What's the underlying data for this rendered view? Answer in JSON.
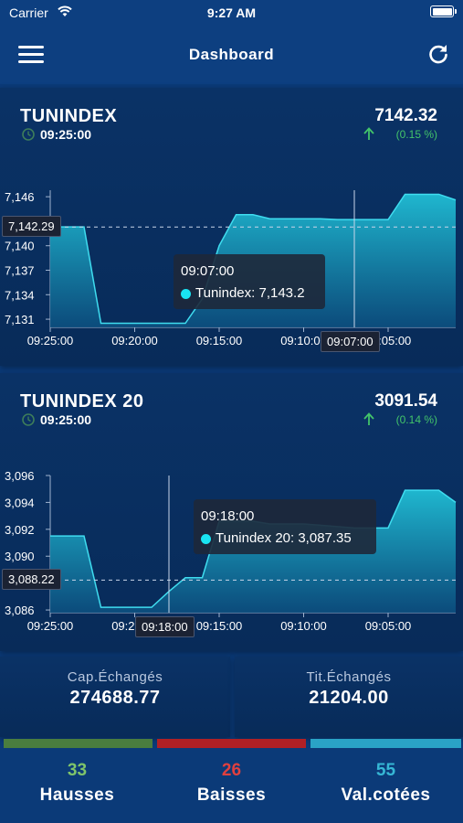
{
  "status_bar": {
    "carrier": "Carrier",
    "time": "9:27 AM"
  },
  "navbar": {
    "title": "Dashboard",
    "menu_icon": "hamburger-menu-icon",
    "refresh_icon": "refresh-icon"
  },
  "cards": [
    {
      "name": "TUNINDEX",
      "time": "09:25:00",
      "value": "7142.32",
      "change": "(0.15 %)",
      "crosshair_value": "7,142.29",
      "tooltip_time": "09:07:00",
      "tooltip_value": "Tunindex: 7,143.2",
      "cursor_badge": "09:07:00",
      "chart_data": {
        "type": "area",
        "series": [
          {
            "name": "Tunindex",
            "x": [
              "09:25:00",
              "09:24:00",
              "09:23:00",
              "09:22:00",
              "09:21:00",
              "09:20:00",
              "09:19:00",
              "09:18:00",
              "09:17:00",
              "09:16:00",
              "09:15:00",
              "09:14:00",
              "09:13:00",
              "09:12:00",
              "09:11:00",
              "09:10:00",
              "09:09:00",
              "09:08:00",
              "09:07:00",
              "09:06:00",
              "09:05:00",
              "09:04:00",
              "09:03:00",
              "09:02:00",
              "09:01:00"
            ],
            "values": [
              7142.3,
              7142.3,
              7142.3,
              7130.5,
              7130.5,
              7130.5,
              7130.5,
              7130.5,
              7130.5,
              7133.5,
              7140.0,
              7143.8,
              7143.8,
              7143.3,
              7143.3,
              7143.3,
              7143.3,
              7143.2,
              7143.2,
              7143.2,
              7143.2,
              7146.3,
              7146.3,
              7146.3,
              7145.6
            ]
          }
        ],
        "y_ticks": [
          "7,146",
          "7,143",
          "7,140",
          "7,137",
          "7,134",
          "7,131"
        ],
        "x_ticks": [
          "09:25:00",
          "09:20:00",
          "09:15:00",
          "09:10:00",
          "09:05:00"
        ],
        "ylim": [
          7130.0,
          7146.8
        ],
        "reference_line": 7142.29
      }
    },
    {
      "name": "TUNINDEX 20",
      "time": "09:25:00",
      "value": "3091.54",
      "change": "(0.14 %)",
      "crosshair_value": "3,088.22",
      "tooltip_time": "09:18:00",
      "tooltip_value": "Tunindex 20: 3,087.35",
      "cursor_badge": "09:18:00",
      "chart_data": {
        "type": "area",
        "series": [
          {
            "name": "Tunindex 20",
            "x": [
              "09:25:00",
              "09:24:00",
              "09:23:00",
              "09:22:00",
              "09:21:00",
              "09:20:00",
              "09:19:00",
              "09:18:00",
              "09:17:00",
              "09:16:00",
              "09:15:00",
              "09:14:00",
              "09:13:00",
              "09:12:00",
              "09:11:00",
              "09:10:00",
              "09:09:00",
              "09:08:00",
              "09:07:00",
              "09:06:00",
              "09:05:00",
              "09:04:00",
              "09:03:00",
              "09:02:00",
              "09:01:00"
            ],
            "values": [
              3091.5,
              3091.5,
              3091.5,
              3086.2,
              3086.2,
              3086.2,
              3086.2,
              3087.35,
              3088.4,
              3088.4,
              3092.6,
              3092.6,
              3092.6,
              3092.4,
              3092.4,
              3092.4,
              3092.3,
              3092.2,
              3092.1,
              3092.1,
              3092.1,
              3094.9,
              3094.9,
              3094.9,
              3094.0
            ]
          }
        ],
        "y_ticks": [
          "3,096",
          "3,094",
          "3,092",
          "3,090",
          "3,088",
          "3,086"
        ],
        "x_ticks": [
          "09:25:00",
          "09:20:00",
          "09:15:00",
          "09:10:00",
          "09:05:00"
        ],
        "ylim": [
          3085.8,
          3096.0
        ],
        "reference_line": 3088.22
      }
    }
  ],
  "stats": {
    "cap_label": "Cap.Échangés",
    "cap_value": "274688.77",
    "tit_label": "Tit.Échangés",
    "tit_value": "21204.00"
  },
  "breadth": {
    "hausses_count": "33",
    "hausses_label": "Hausses",
    "baisses_count": "26",
    "baisses_label": "Baisses",
    "valcotees_count": "55",
    "valcotees_label": "Val.cotées",
    "colors": {
      "hausses": "#4a7d3f",
      "baisses": "#b02025",
      "valcotees": "#2aa3c6"
    },
    "text_colors": {
      "hausses": "#7fc46a",
      "baisses": "#e0403e",
      "valcotees": "#36b7d5"
    }
  }
}
